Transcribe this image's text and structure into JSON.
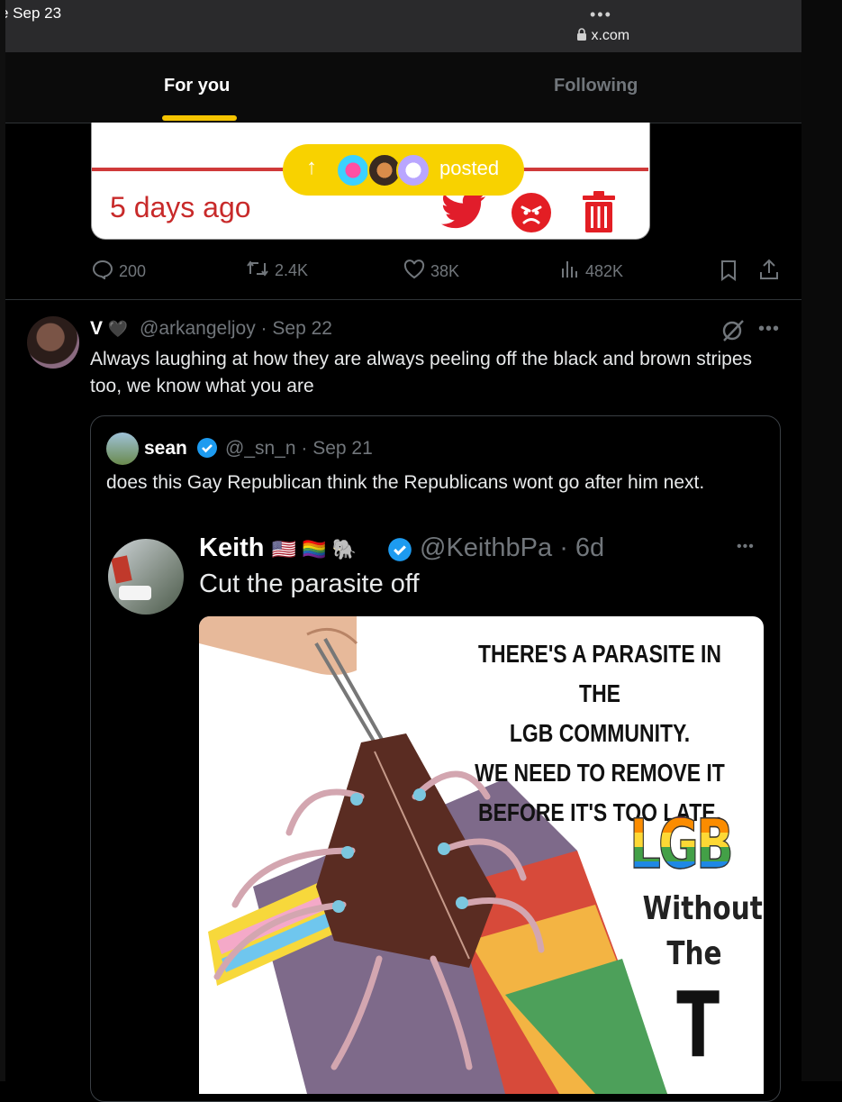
{
  "status_bar": {
    "date": "e Sep 23",
    "more_label": "•••",
    "url": "x.com"
  },
  "tabs": [
    {
      "label": "For you",
      "active": true
    },
    {
      "label": "Following",
      "active": false
    }
  ],
  "colors": {
    "accent": "#f5c400",
    "muted": "#71767b",
    "embed_red": "#c82a2a",
    "verified": "#1d9bf0"
  },
  "embed": {
    "date_text": "5 days ago"
  },
  "new_posts_pill": {
    "arrow": "↑",
    "label": "posted"
  },
  "metrics": {
    "replies": "200",
    "reposts": "2.4K",
    "likes": "38K",
    "views": "482K"
  },
  "post": {
    "display_name": "V",
    "heart": "🖤",
    "handle_date": "@arkangeljoy · Sep 22",
    "text": "Always laughing at how they are always peeling off the black and brown stripes too, we know what you are",
    "more_label": "•••",
    "quote": {
      "display_name": "sean",
      "handle_date": "@_sn_n · Sep 21",
      "text": "does this Gay Republican think the Republicans wont go after him next.",
      "nested": {
        "display_name": "Keith",
        "emojis": "🇺🇸 🏳️‍🌈 🐘",
        "handle_date": "@KeithbPa · 6d",
        "text": "Cut the parasite off",
        "more_label": "•••",
        "image": {
          "headline": [
            "THERE'S A PARASITE IN THE",
            "LGB COMMUNITY.",
            "WE NEED TO REMOVE IT",
            "BEFORE IT'S TOO LATE."
          ],
          "logo_text": "LGB",
          "subtitle": [
            "Without",
            "The"
          ],
          "big_letter": "T"
        }
      }
    }
  }
}
